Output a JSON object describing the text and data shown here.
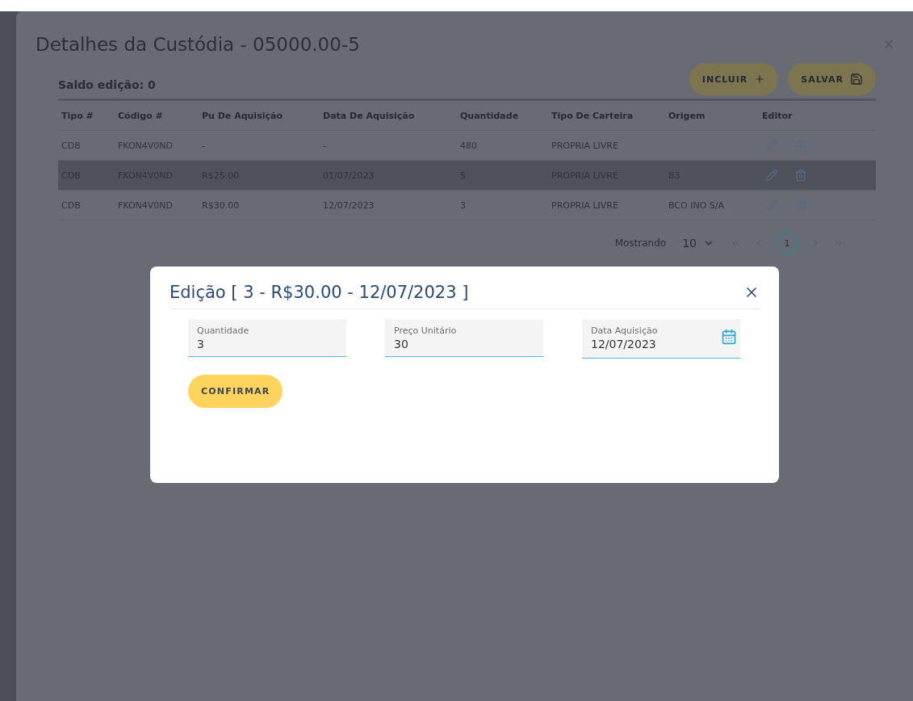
{
  "background": {
    "title": "Detalhes da Custódia - 05000.00-5",
    "balance": "Saldo edição: 0",
    "actions": [
      {
        "label": "INCLUIR",
        "kind": "add"
      },
      {
        "label": "SALVAR",
        "kind": "save"
      }
    ],
    "table": {
      "columns": [
        "Tipo #",
        "Código #",
        "Pu De Aquisição",
        "Data De Aquisição",
        "Quantidade",
        "Tipo De Carteira",
        "Origem",
        "Editor"
      ],
      "rows": [
        {
          "cells": [
            "CDB",
            "FKON4V0ND",
            "-",
            "-",
            "480",
            "PROPRIA LIVRE",
            ""
          ],
          "highlighted": false
        },
        {
          "cells": [
            "CDB",
            "FKON4V0ND",
            "R$25.00",
            "01/07/2023",
            "5",
            "PROPRIA LIVRE",
            "B3"
          ],
          "highlighted": true
        },
        {
          "cells": [
            "CDB",
            "FKON4V0ND",
            "R$30.00",
            "12/07/2023",
            "3",
            "PROPRIA LIVRE",
            "BCO INO S/A"
          ],
          "highlighted": false
        }
      ]
    },
    "pagination": {
      "label": "Mostrando",
      "page_size": "10",
      "pages": [
        {
          "label": "1",
          "selected": true
        }
      ]
    }
  },
  "dialog": {
    "title": "Edição [ 3 - R$30.00 - 12/07/2023 ]",
    "fields": [
      {
        "label": "Quantidade",
        "value": "3",
        "kind": "text"
      },
      {
        "label": "Preço Unitário",
        "value": "30",
        "kind": "text"
      },
      {
        "label": "Data Aquisição",
        "value": "12/07/2023",
        "kind": "date"
      }
    ],
    "confirm": "CONFIRMAR"
  }
}
